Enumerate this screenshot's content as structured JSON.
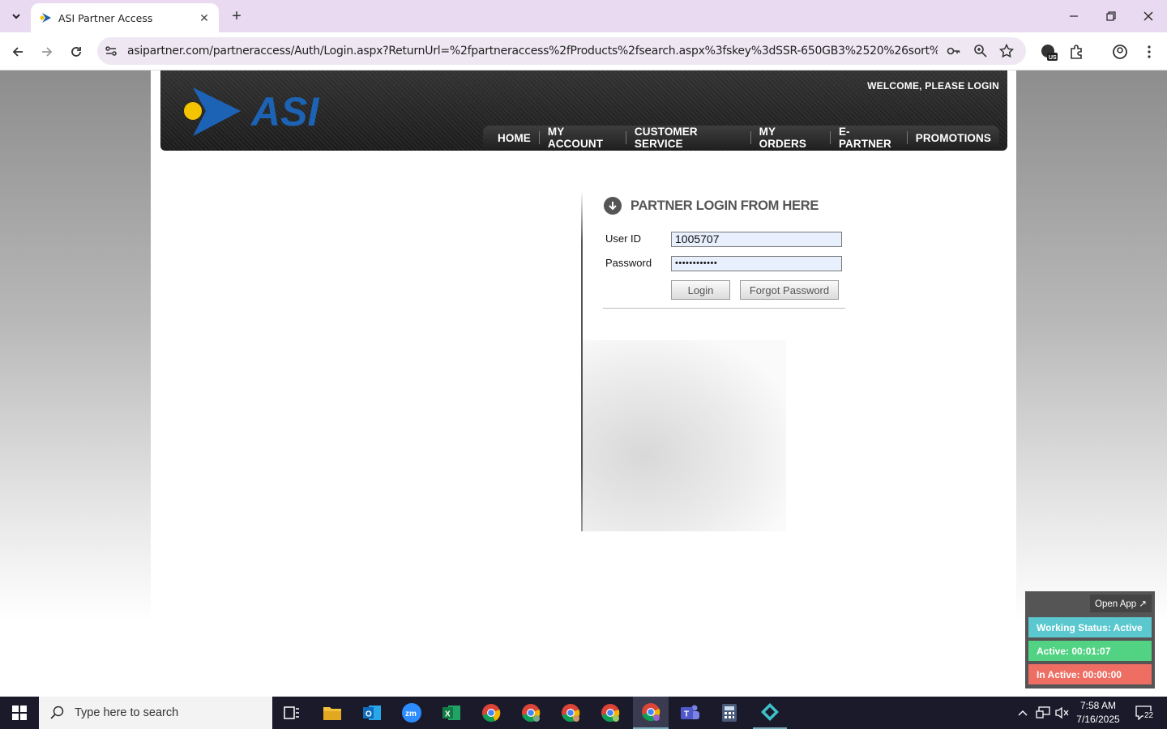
{
  "browser": {
    "tab_title": "ASI Partner Access",
    "url": "asipartner.com/partneraccess/Auth/Login.aspx?ReturnUrl=%2fpartneraccess%2fProducts%2fsearch.aspx%3fskey%3dSSR-650GB3%2520%26sort%3dprice-asc%2..."
  },
  "header": {
    "welcome": "WELCOME, PLEASE LOGIN",
    "logo_text": "ASI",
    "nav": [
      "HOME",
      "MY ACCOUNT",
      "CUSTOMER SERVICE",
      "MY ORDERS",
      "E-PARTNER",
      "PROMOTIONS"
    ]
  },
  "login": {
    "heading": "PARTNER LOGIN FROM HERE",
    "user_label": "User ID",
    "user_value": "1005707",
    "password_label": "Password",
    "password_value": "••••••••••••",
    "login_button": "Login",
    "forgot_button": "Forgot Password"
  },
  "widget": {
    "open_app": "Open App ↗",
    "status": "Working Status: Active",
    "active": "Active: 00:01:07",
    "inactive": "In Active: 00:00:00",
    "colors": {
      "status": "#5bc8cf",
      "active": "#52d283",
      "inactive": "#ee6e63"
    }
  },
  "taskbar": {
    "search_placeholder": "Type here to search",
    "time": "7:58 AM",
    "date": "7/16/2025",
    "notifications": "22"
  }
}
